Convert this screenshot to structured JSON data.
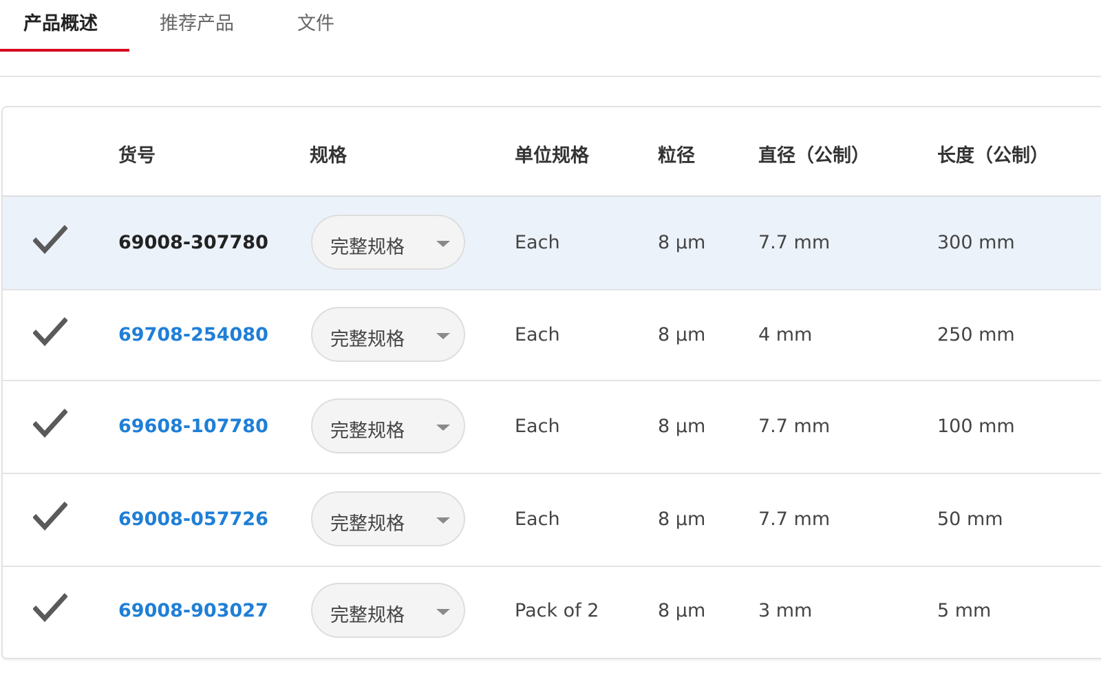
{
  "tabs": [
    {
      "label": "产品概述",
      "active": true
    },
    {
      "label": "推荐产品",
      "active": false
    },
    {
      "label": "文件",
      "active": false
    }
  ],
  "table": {
    "headers": {
      "part_number": "货号",
      "spec": "规格",
      "unit": "单位规格",
      "particle_size": "粒径",
      "diameter": "直径（公制）",
      "length": "长度（公制）"
    },
    "rows": [
      {
        "part_number": "69008-307780",
        "spec": "完整规格",
        "unit": "Each",
        "particle_size": "8 µm",
        "diameter": "7.7 mm",
        "length": "300 mm",
        "selected": true
      },
      {
        "part_number": "69708-254080",
        "spec": "完整规格",
        "unit": "Each",
        "particle_size": "8 µm",
        "diameter": "4 mm",
        "length": "250 mm",
        "selected": false
      },
      {
        "part_number": "69608-107780",
        "spec": "完整规格",
        "unit": "Each",
        "particle_size": "8 µm",
        "diameter": "7.7 mm",
        "length": "100 mm",
        "selected": false
      },
      {
        "part_number": "69008-057726",
        "spec": "完整规格",
        "unit": "Each",
        "particle_size": "8 µm",
        "diameter": "7.7 mm",
        "length": "50 mm",
        "selected": false
      },
      {
        "part_number": "69008-903027",
        "spec": "完整规格",
        "unit": "Pack of 2",
        "particle_size": "8 µm",
        "diameter": "3 mm",
        "length": "5 mm",
        "selected": false
      }
    ]
  },
  "icons": {
    "row_check": "checkmark-icon",
    "spec_caret": "chevron-down-icon"
  },
  "colors": {
    "accent": "#d6001c",
    "link": "#1f7fd6",
    "selected_row": "#ebf2fa",
    "check": "#5a5a5a"
  }
}
